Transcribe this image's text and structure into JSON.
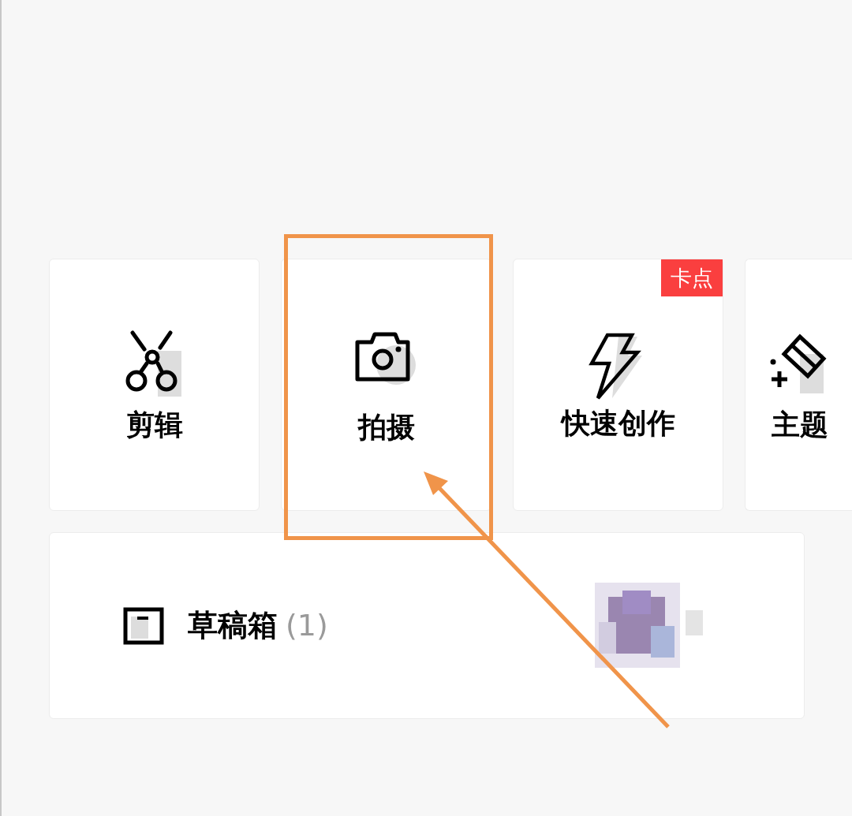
{
  "cards": [
    {
      "kind": "scissors",
      "label": "剪辑",
      "highlighted": false
    },
    {
      "kind": "camera",
      "label": "拍摄",
      "highlighted": true
    },
    {
      "kind": "bolt",
      "label": "快速创作",
      "badge": "卡点",
      "highlighted": false
    },
    {
      "kind": "wand",
      "label": "主题",
      "highlighted": false
    }
  ],
  "drafts": {
    "label": "草稿箱",
    "count": "(1)"
  }
}
